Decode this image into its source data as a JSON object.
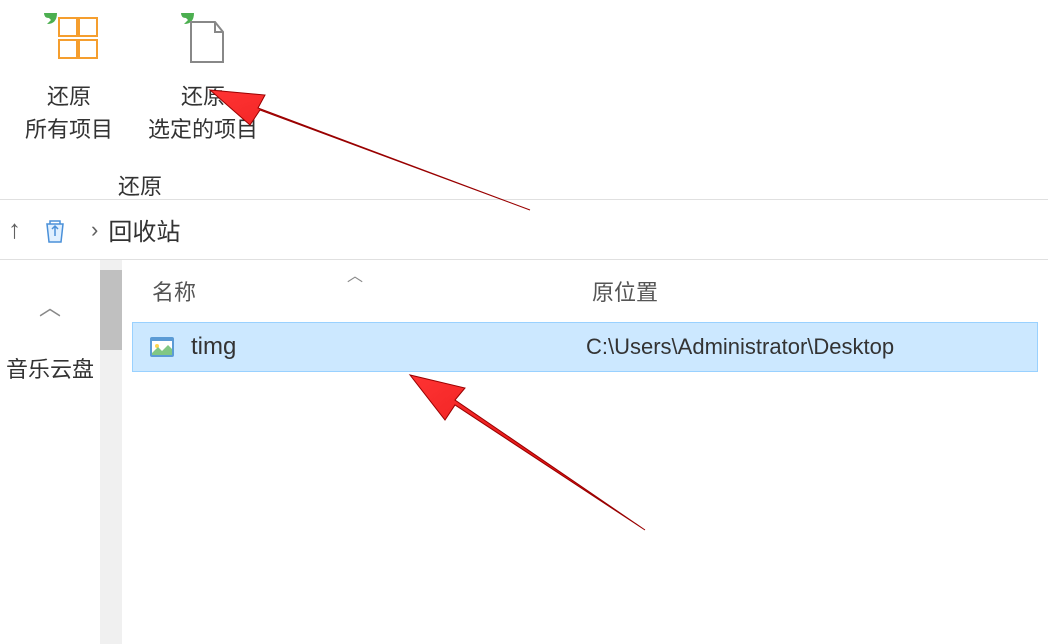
{
  "ribbon": {
    "restoreAll": {
      "line1": "还原",
      "line2": "所有项目"
    },
    "restoreSelected": {
      "line1": "还原",
      "line2": "选定的项目"
    },
    "groupLabel": "还原"
  },
  "addressBar": {
    "location": "回收站"
  },
  "sidebar": {
    "item": "音乐云盘"
  },
  "columns": {
    "name": "名称",
    "originalLocation": "原位置"
  },
  "files": [
    {
      "name": "timg",
      "originalLocation": "C:\\Users\\Administrator\\Desktop"
    }
  ]
}
